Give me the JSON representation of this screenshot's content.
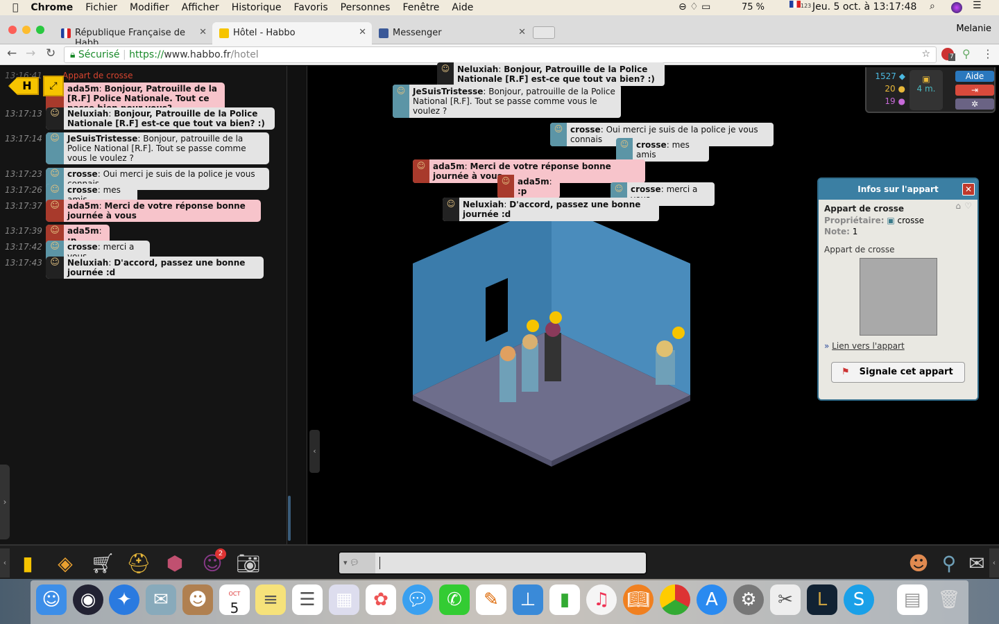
{
  "menubar": {
    "app": "Chrome",
    "items": [
      "Fichier",
      "Modifier",
      "Afficher",
      "Historique",
      "Favoris",
      "Personnes",
      "Fenêtre",
      "Aide"
    ],
    "battery": "75 %",
    "datetime": "Jeu. 5 oct. à  13:17:48",
    "keyboard": "123"
  },
  "browser": {
    "tabs": [
      {
        "label": "République Française de Habb",
        "active": false
      },
      {
        "label": "Hôtel - Habbo",
        "active": true
      },
      {
        "label": "Messenger",
        "active": false
      }
    ],
    "profile": "Melanie",
    "secure": "Sécurisé",
    "url_scheme": "https://",
    "url_host": "www.habbo.fr",
    "url_path": "/hotel",
    "ext_badge": "7"
  },
  "chat_log": {
    "room_label": "Appart de crosse",
    "first_time": "13:16:41",
    "entries": [
      {
        "time": "13:17:1",
        "user": "ada5m",
        "text": "Bonjour, Patrouille de la [R.F] Police Nationale. Tout ce passe bien pour vous?",
        "style": "pink",
        "bold": true
      },
      {
        "time": "13:17:13",
        "user": "Neluxiah",
        "text": "Bonjour, Patrouille de la Police Nationale [R.F] est-ce que tout va bien? :)",
        "style": "gray-dark",
        "bold": true
      },
      {
        "time": "13:17:14",
        "user": "JeSuisTristesse",
        "text": "Bonjour, patrouille de la Police National [R.F]. Tout se passe comme vous le voulez ?",
        "style": "gray-teal",
        "bold": false
      },
      {
        "time": "13:17:23",
        "user": "crosse",
        "text": "Oui merci je suis de la police je vous connais",
        "style": "gray-teal",
        "bold": false
      },
      {
        "time": "13:17:26",
        "user": "crosse",
        "text": "mes amis",
        "style": "gray-teal",
        "bold": false
      },
      {
        "time": "13:17:37",
        "user": "ada5m",
        "text": "Merci de votre réponse bonne journée à vous",
        "style": "pink",
        "bold": true
      },
      {
        "time": "13:17:39",
        "user": "ada5m",
        "text": ":p",
        "style": "pink",
        "bold": true
      },
      {
        "time": "13:17:42",
        "user": "crosse",
        "text": "merci a vous",
        "style": "gray-teal",
        "bold": false
      },
      {
        "time": "13:17:43",
        "user": "Neluxiah",
        "text": "D'accord, passez une bonne journée :d",
        "style": "gray-dark",
        "bold": true
      }
    ]
  },
  "room_bubbles": [
    {
      "user": "Neluxiah",
      "text": "Bonjour, Patrouille de la Police Nationale [R.F] est-ce que tout va bien? :)",
      "style": "gray-dark",
      "bold": true
    },
    {
      "user": "JeSuisTristesse",
      "text": "Bonjour, patrouille de la Police National [R.F]. Tout se passe comme vous le voulez ?",
      "style": "gray-teal",
      "bold": false
    },
    {
      "user": "crosse",
      "text": "Oui merci je suis de la police je vous connais",
      "style": "gray-teal",
      "bold": false
    },
    {
      "user": "crosse",
      "text": "mes amis",
      "style": "gray-teal",
      "bold": false
    },
    {
      "user": "ada5m",
      "text": "Merci de votre réponse bonne journée à vous",
      "style": "pink",
      "bold": true
    },
    {
      "user": "ada5m",
      "text": ":p",
      "style": "pink",
      "bold": true
    },
    {
      "user": "crosse",
      "text": "merci a vous",
      "style": "gray-teal",
      "bold": false
    },
    {
      "user": "Neluxiah",
      "text": "D'accord, passez une bonne journée :d",
      "style": "gray-dark",
      "bold": true
    }
  ],
  "hud": {
    "diamonds": "1527",
    "credits": "20",
    "duckets": "19",
    "hc": "4 m.",
    "help": "Aide"
  },
  "room_info": {
    "title": "Infos sur l'appart",
    "name": "Appart de crosse",
    "owner_label": "Propriétaire:",
    "owner": "crosse",
    "rating_label": "Note:",
    "rating": "1",
    "description": "Appart de crosse",
    "link": "Lien vers l'appart",
    "report": "Signale cet appart"
  },
  "toolbar": {
    "messenger_badge": "2"
  },
  "dock": {
    "calendar_month": "OCT",
    "calendar_day": "5"
  },
  "colors": {
    "pink": "#f7c4cb",
    "wall": "#3f82ae",
    "info_header": "#3b7fa3"
  }
}
